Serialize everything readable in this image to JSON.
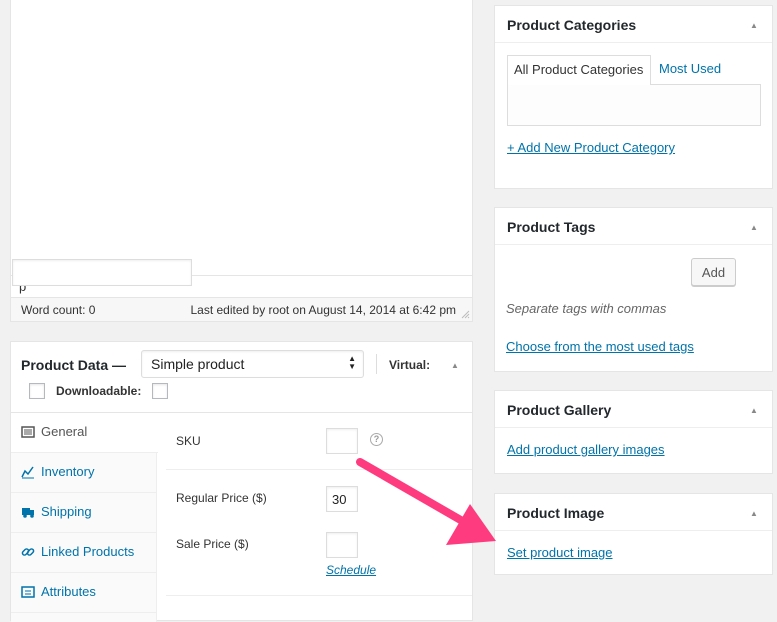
{
  "editor": {
    "path": "p",
    "word_count": "Word count: 0",
    "last_edited": "Last edited by root on August 14, 2014 at 6:42 pm"
  },
  "product_data": {
    "title": "Product Data —",
    "type_select": "Simple product",
    "virtual_label": "Virtual:",
    "downloadable_label": "Downloadable:",
    "tabs": [
      {
        "label": "General",
        "icon": "general-icon"
      },
      {
        "label": "Inventory",
        "icon": "inventory-icon"
      },
      {
        "label": "Shipping",
        "icon": "shipping-icon"
      },
      {
        "label": "Linked Products",
        "icon": "link-icon"
      },
      {
        "label": "Attributes",
        "icon": "attributes-icon"
      }
    ],
    "fields": {
      "sku_label": "SKU",
      "sku_value": "",
      "regular_price_label": "Regular Price ($)",
      "regular_price_value": "30",
      "sale_price_label": "Sale Price ($)",
      "sale_price_value": "",
      "schedule_link": "Schedule"
    }
  },
  "product_categories": {
    "title": "Product Categories",
    "tab_all": "All Product Categories",
    "tab_most_used": "Most Used",
    "add_new": "+ Add New Product Category"
  },
  "product_tags": {
    "title": "Product Tags",
    "input_value": "",
    "add_button": "Add",
    "hint": "Separate tags with commas",
    "choose_link": "Choose from the most used tags"
  },
  "product_gallery": {
    "title": "Product Gallery",
    "add_link": "Add product gallery images"
  },
  "product_image": {
    "title": "Product Image",
    "set_link": "Set product image"
  },
  "colors": {
    "link": "#0073aa",
    "arrow": "#ff3b7f",
    "background": "#f1f1f1"
  }
}
